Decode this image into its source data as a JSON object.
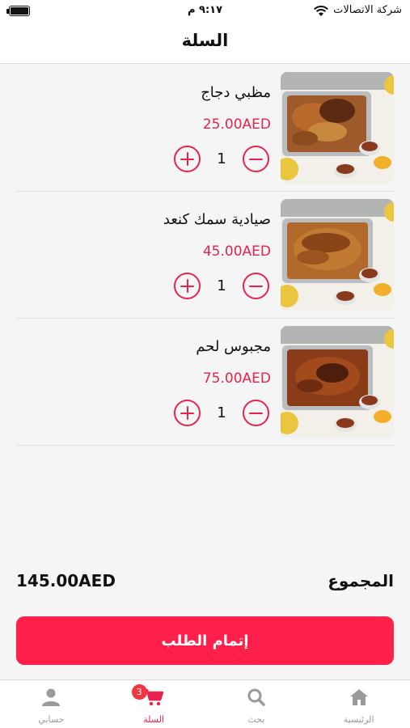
{
  "status_bar": {
    "carrier": "شركة الاتصالات",
    "time": "٩:١٧ م"
  },
  "header": {
    "title": "السلة"
  },
  "cart": {
    "items": [
      {
        "name": "مظبي دجاج",
        "price": "25.00AED",
        "quantity": "1"
      },
      {
        "name": "صيادية سمك كنعد",
        "price": "45.00AED",
        "quantity": "1"
      },
      {
        "name": "مجبوس لحم",
        "price": "75.00AED",
        "quantity": "1"
      }
    ]
  },
  "summary": {
    "total_label": "المجموع",
    "total_value": "145.00AED"
  },
  "checkout": {
    "label": "إتمام الطلب"
  },
  "tab_bar": {
    "tabs": [
      {
        "label": "الرئيسية",
        "icon": "home-icon"
      },
      {
        "label": "بحث",
        "icon": "search-icon"
      },
      {
        "label": "السلة",
        "icon": "cart-icon",
        "badge": "3",
        "active": true
      },
      {
        "label": "حسابي",
        "icon": "user-icon"
      }
    ]
  },
  "colors": {
    "accent": "#e8234e",
    "button": "#ff1f4b",
    "badge": "#f0353f",
    "inactive_tab": "#9a9a9a"
  }
}
